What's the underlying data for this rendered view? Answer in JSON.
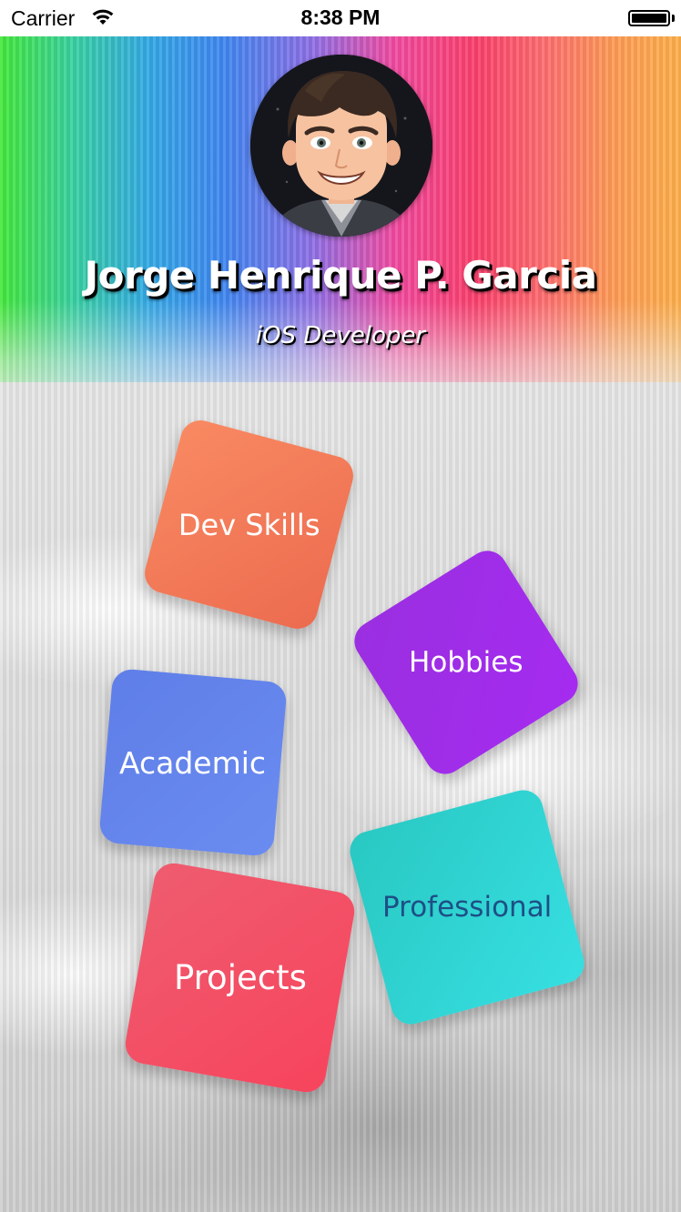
{
  "status_bar": {
    "carrier": "Carrier",
    "time": "8:38 PM",
    "wifi_icon": "wifi-icon",
    "battery_icon": "battery-full-icon"
  },
  "profile": {
    "name": "Jorge Henrique P. Garcia",
    "role": "iOS Developer",
    "avatar_icon": "cartoon-avatar"
  },
  "menu": {
    "dev_skills": "Dev Skills",
    "hobbies": "Hobbies",
    "academic": "Academic",
    "professional": "Professional",
    "projects": "Projects"
  },
  "colors": {
    "dev_skills": "#f07a58",
    "hobbies": "#a02ceb",
    "academic": "#6585ec",
    "professional": "#31d6d4",
    "projects": "#f24e64",
    "professional_text": "#1e4f86",
    "tile_text": "#ffffff"
  }
}
